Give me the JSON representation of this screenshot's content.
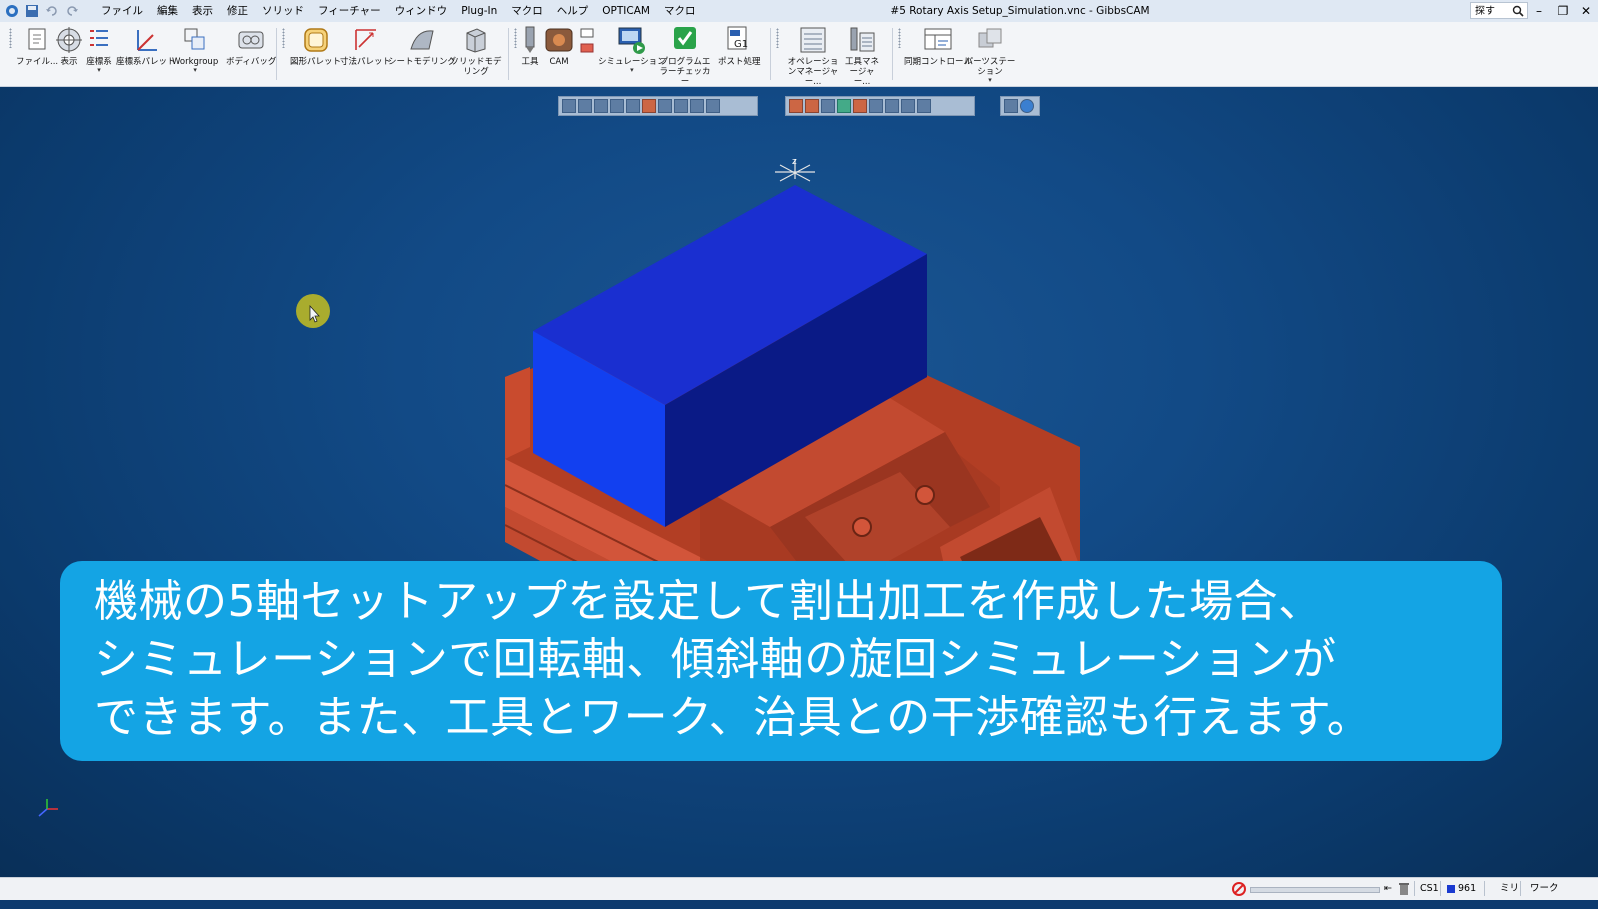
{
  "titlebar": {
    "window_title": "#5 Rotary Axis Setup_Simulation.vnc - GibbsCAM",
    "menu": [
      "ファイル",
      "編集",
      "表示",
      "修正",
      "ソリッド",
      "フィーチャー",
      "ウィンドウ",
      "Plug-In",
      "マクロ",
      "ヘルプ",
      "OPTICAM",
      "マクロ"
    ],
    "search_placeholder": "探す"
  },
  "ribbon": {
    "file": "ファイル...",
    "view": "表示",
    "coord": "座標系",
    "coord_palette": "座標系パレット",
    "workgroup": "Workgroup",
    "body_bag": "ボディバッグ",
    "shape_palette": "図形パレット",
    "dimension_palette": "寸法パレット",
    "sheet_modeling": "シートモデリング",
    "solid_modeling": "ソリッドモデリング",
    "tool": "工具",
    "cam": "CAM",
    "simulation": "シミュレーション",
    "error_checker": "プログラムエラーチェッカー",
    "post": "ポスト処理",
    "operation_manager": "オペレーションマネージャー...",
    "tool_manager": "工具マネージャー...",
    "sync_control": "同期コントロール",
    "parts_station": "パーツステーション"
  },
  "subtitle": {
    "line1": "機械の5軸セットアップを設定して割出加工を作成した場合、",
    "line2": "シミュレーションで回転軸、傾斜軸の旋回シミュレーションが",
    "line3": "できます。また、工具とワーク、治具との干渉確認も行えます。"
  },
  "statusbar": {
    "cs": "CS1",
    "layer": "961",
    "unit": "ミリ",
    "mode": "ワーク"
  },
  "colors": {
    "stock_top": "#1a2fd0",
    "stock_left": "#1240f0",
    "stock_right": "#0a1a86",
    "vise": "#c94b2e",
    "subtitle_bg": "#14a4e4",
    "viewport_bg": "#124a86"
  }
}
